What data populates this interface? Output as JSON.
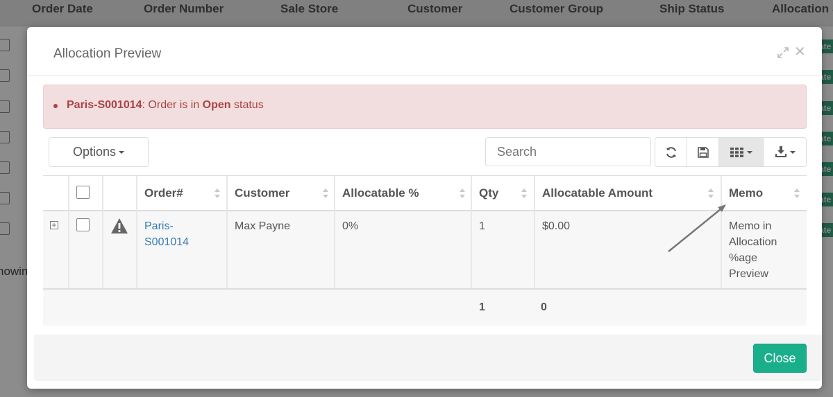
{
  "background": {
    "columns": [
      "Order Date",
      "Order Number",
      "Sale Store",
      "Customer",
      "Customer Group",
      "Ship Status",
      "Allocation S"
    ],
    "tag_text": "ate",
    "showing_text": "howin"
  },
  "modal": {
    "title": "Allocation Preview",
    "alert": {
      "order": "Paris-S001014",
      "text_before": ": Order is in ",
      "status": "Open",
      "text_after": " status"
    },
    "toolbar": {
      "options_label": "Options",
      "search_placeholder": "Search"
    },
    "table": {
      "headers": [
        "Order#",
        "Customer",
        "Allocatable %",
        "Qty",
        "Allocatable Amount",
        "Memo"
      ],
      "row": {
        "order_line1": "Paris-",
        "order_line2": "S001014",
        "customer": "Max Payne",
        "allocatable_pct": "0%",
        "qty": "1",
        "allocatable_amount": "$0.00",
        "memo_lines": [
          "Memo in",
          "Allocation",
          "%age",
          "Preview"
        ]
      },
      "footer": {
        "qty_total": "1",
        "amount_total": "0"
      }
    },
    "close_label": "Close"
  },
  "colors": {
    "accent": "#1aaf8b",
    "alert_bg": "#f2dede",
    "alert_text": "#a94442",
    "link": "#337ab7"
  }
}
